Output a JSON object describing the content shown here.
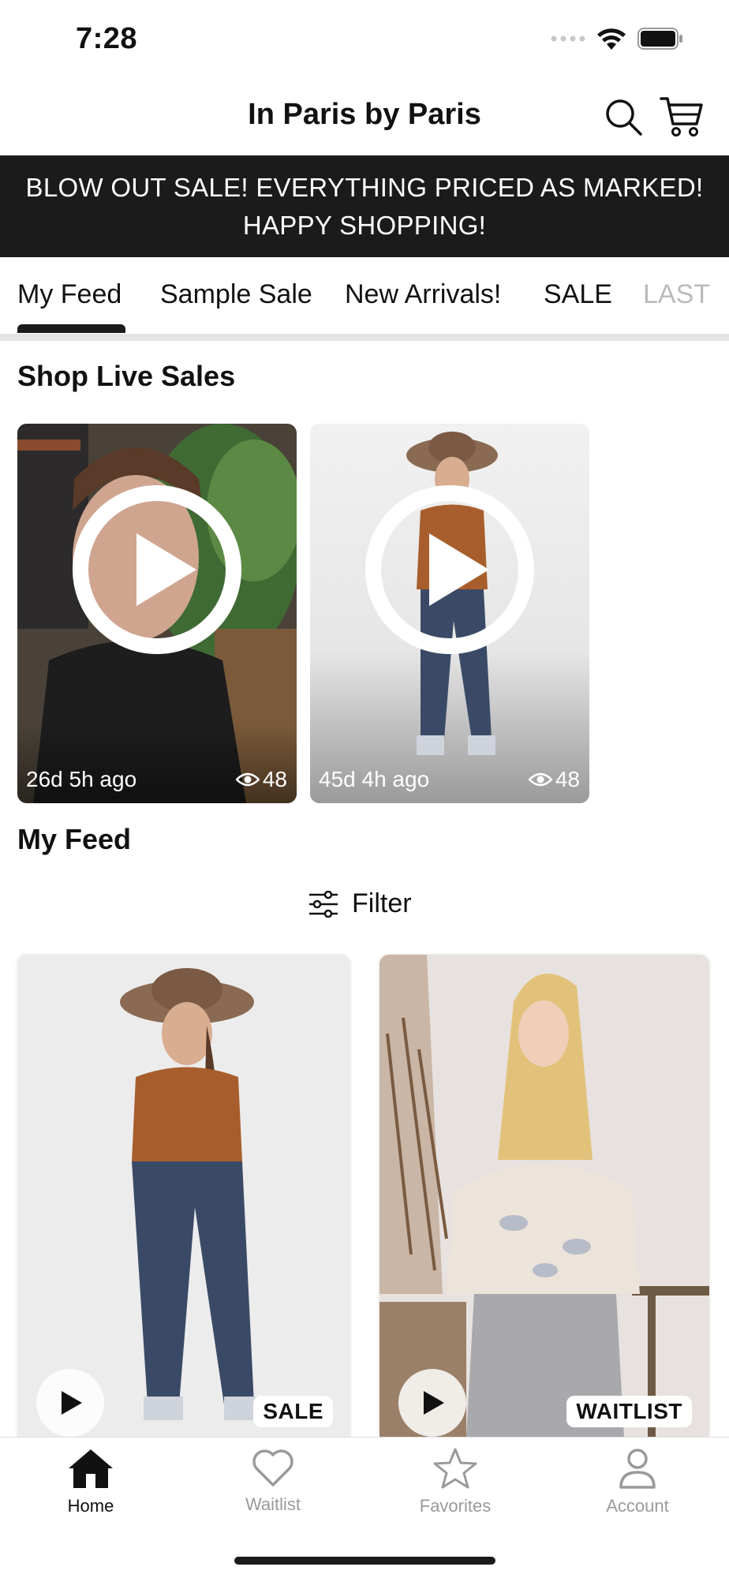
{
  "status_bar": {
    "time": "7:28"
  },
  "header": {
    "title": "In Paris by Paris",
    "search_icon": "search-icon",
    "cart_icon": "cart-icon"
  },
  "banner": {
    "line1": "BLOW OUT SALE! EVERYTHING PRICED AS MARKED!",
    "line2": "HAPPY SHOPPING!"
  },
  "tabs": [
    {
      "label": "My Feed",
      "active": true
    },
    {
      "label": "Sample Sale"
    },
    {
      "label": "New Arrivals!"
    },
    {
      "label": "SALE"
    },
    {
      "label": "LAST"
    }
  ],
  "live_sales": {
    "title": "Shop Live Sales",
    "items": [
      {
        "age": "26d 5h ago",
        "views": "48"
      },
      {
        "age": "45d 4h ago",
        "views": "48"
      }
    ]
  },
  "feed": {
    "title": "My Feed",
    "filter_label": "Filter",
    "items": [
      {
        "tag": "SALE"
      },
      {
        "tag": "WAITLIST"
      }
    ]
  },
  "bottom_nav": [
    {
      "label": "Home",
      "icon": "home-icon",
      "active": true
    },
    {
      "label": "Waitlist",
      "icon": "heart-icon"
    },
    {
      "label": "Favorites",
      "icon": "star-icon"
    },
    {
      "label": "Account",
      "icon": "person-icon"
    }
  ],
  "colors": {
    "banner_bg": "#1b1b1b",
    "accent": "#111111",
    "inactive": "#9a9a9a"
  }
}
